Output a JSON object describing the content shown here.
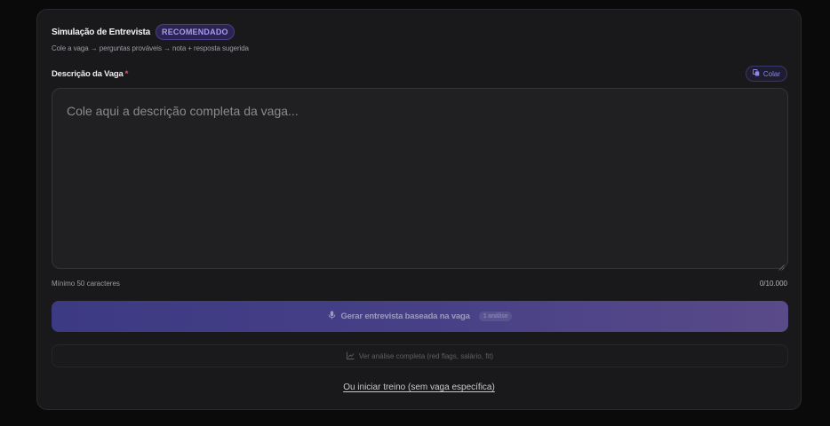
{
  "header": {
    "title": "Simulação de Entrevista",
    "badge": "RECOMENDADO",
    "subtitle": "Cole a vaga → perguntas prováveis → nota + resposta sugerida"
  },
  "field": {
    "label": "Descrição da Vaga",
    "required_mark": "*",
    "paste_label": "Colar",
    "paste_icon": "clipboard-icon",
    "placeholder": "Cole aqui a descrição completa da vaga...",
    "value": "",
    "min_hint": "Mínimo 50 caracteres",
    "counter": "0/10.000"
  },
  "actions": {
    "generate_label": "Gerar entrevista baseada na vaga",
    "generate_icon": "microphone-icon",
    "generate_count": "1 análise",
    "analysis_label": "Ver análise completa (red flags, salário, fit)",
    "analysis_icon": "chart-line-icon",
    "start_link": "Ou iniciar treino (sem vaga específica)"
  },
  "colors": {
    "accent": "#8f86e8",
    "badge_bg": "#2b2450",
    "gradient_start": "#3f3d8c",
    "gradient_end": "#5f4e92",
    "required": "#e0566a"
  }
}
